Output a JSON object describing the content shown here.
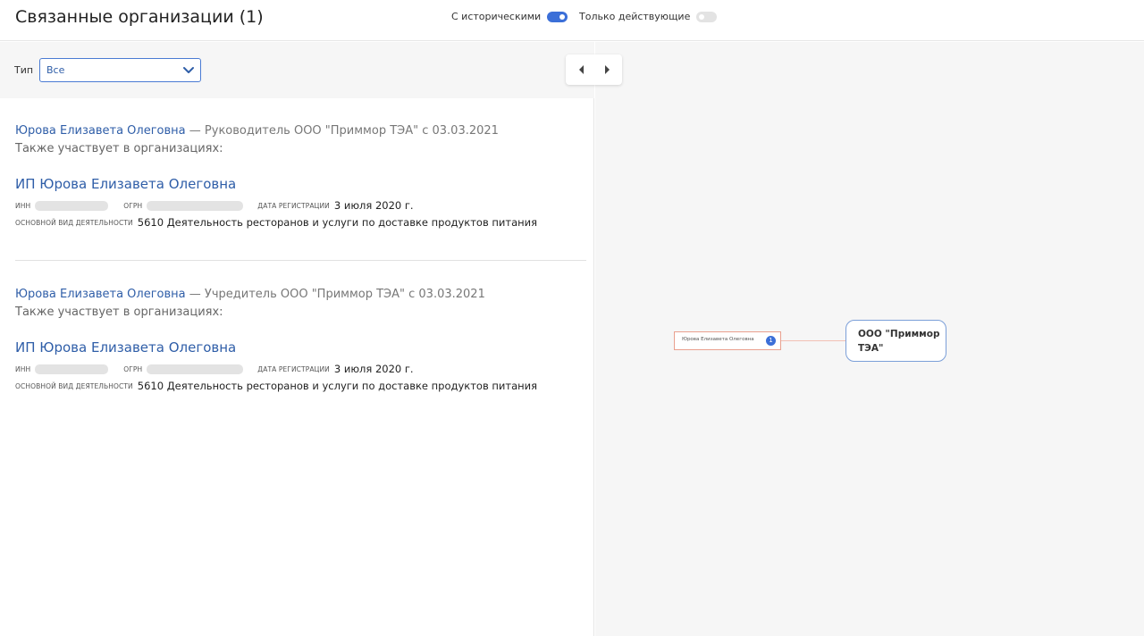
{
  "header": {
    "title": "Связанные организации (1)",
    "toggle_historical": {
      "label": "С историческими",
      "on": true
    },
    "toggle_active_only": {
      "label": "Только действующие",
      "on": false
    }
  },
  "filter": {
    "type_label": "Тип",
    "type_value": "Все"
  },
  "entries": [
    {
      "person": "Юрова Елизавета Олеговна",
      "role": " — Руководитель ООО \"Приммор ТЭА\" с 03.03.2021",
      "also": "Также участвует в организациях:",
      "org_name": "ИП Юрова Елизавета Олеговна",
      "inn_label": "ИНН",
      "ogrn_label": "ОГРН",
      "reg_date_label": "ДАТА РЕГИСТРАЦИИ",
      "reg_date": "3 июля 2020 г.",
      "activity_label": "ОСНОВНОЙ ВИД ДЕЯТЕЛЬНОСТИ",
      "activity": "5610 Деятельность ресторанов и услуги по доставке продуктов питания"
    },
    {
      "person": "Юрова Елизавета Олеговна",
      "role": " — Учредитель ООО \"Приммор ТЭА\" с 03.03.2021",
      "also": "Также участвует в организациях:",
      "org_name": "ИП Юрова Елизавета Олеговна",
      "inn_label": "ИНН",
      "ogrn_label": "ОГРН",
      "reg_date_label": "ДАТА РЕГИСТРАЦИИ",
      "reg_date": "3 июля 2020 г.",
      "activity_label": "ОСНОВНОЙ ВИД ДЕЯТЕЛЬНОСТИ",
      "activity": "5610 Деятельность ресторанов и услуги по доставке продуктов питания"
    }
  ],
  "graph": {
    "person_node": "Юрова Елизавета Олеговна",
    "person_badge": "1",
    "org_node": "ООО \"Приммор ТЭА\""
  },
  "colors": {
    "accent": "#3b6fd8",
    "link": "#2f5ea8",
    "person_node_border": "#e9a08f",
    "org_node_border": "#7b9fd8"
  }
}
